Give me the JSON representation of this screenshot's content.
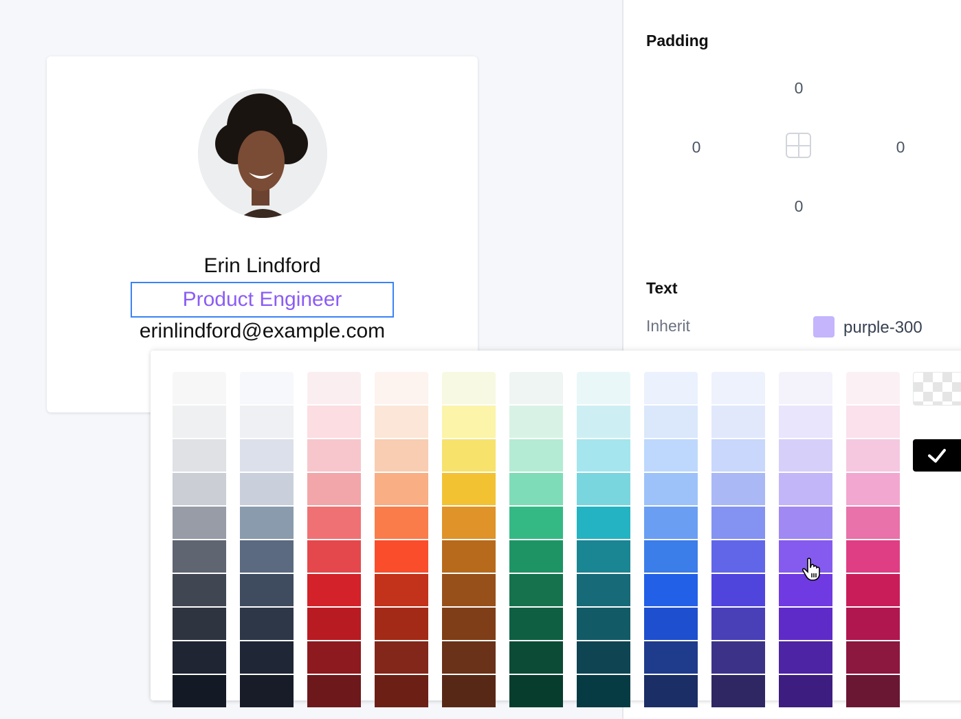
{
  "card": {
    "name": "Erin Lindford",
    "title": "Product Engineer",
    "email": "erinlindford@example.com",
    "title_color": "#8b5cf6",
    "selection_color": "#3b82f6"
  },
  "panel": {
    "padding_heading": "Padding",
    "padding": {
      "top": "0",
      "left": "0",
      "right": "0",
      "bottom": "0"
    },
    "text_heading": "Text",
    "inherit_label": "Inherit",
    "current_color_name": "purple-300",
    "current_color": "#c4b5fd"
  },
  "palette": {
    "selected": "purple-300",
    "columns": [
      [
        "#f7f7f8",
        "#eff0f2",
        "#dfe1e5",
        "#cbced4",
        "#979ca6",
        "#5f6571",
        "#404752",
        "#2e3440",
        "#1f2533",
        "#141a25"
      ],
      [
        "#f6f8fb",
        "#eef0f4",
        "#dce0ea",
        "#c9d0dc",
        "#8a9bad",
        "#5b6a80",
        "#3f4b5e",
        "#2e3748",
        "#1f2636",
        "#171c28"
      ],
      [
        "#fbeef0",
        "#fbdde2",
        "#f7c6cc",
        "#f2a6a9",
        "#f07174",
        "#e5484c",
        "#d32229",
        "#b91b23",
        "#8d1a1e",
        "#6d181b"
      ],
      [
        "#fdf3ef",
        "#fbe6d8",
        "#f9cdb1",
        "#f9ae84",
        "#fa7c4a",
        "#fa4d2c",
        "#c3321a",
        "#a32a17",
        "#83271a",
        "#6c1f14"
      ],
      [
        "#f8f9e2",
        "#fbf4a9",
        "#f7e26c",
        "#f2c233",
        "#df9329",
        "#b86a1c",
        "#97501a",
        "#7f3e17",
        "#6a3218",
        "#582816"
      ],
      [
        "#eff5f2",
        "#d8f3e6",
        "#b3ebd4",
        "#7fdcb8",
        "#34b985",
        "#1e9465",
        "#15724d",
        "#0f5f43",
        "#0c4b36",
        "#073d2d"
      ],
      [
        "#e9f7f8",
        "#cdeff3",
        "#a5e5ed",
        "#79d6de",
        "#23b3c2",
        "#1a8593",
        "#176a77",
        "#125a66",
        "#0f4553",
        "#073b44"
      ],
      [
        "#ebf1fd",
        "#dbe7fb",
        "#bdd8fc",
        "#9dc2fa",
        "#6a9ef3",
        "#3b7de9",
        "#2260e7",
        "#1e4fcf",
        "#1f3c8c",
        "#1c2e66"
      ],
      [
        "#eef2fd",
        "#e1e8fc",
        "#c8d7fb",
        "#aab9f6",
        "#8492f1",
        "#6166e9",
        "#4f45dd",
        "#4940b8",
        "#3c3388",
        "#2e2763"
      ],
      [
        "#f4f3fc",
        "#e8e5fc",
        "#d6cffa",
        "#c3b6f8",
        "#a189f3",
        "#855bef",
        "#6f3ae1",
        "#5f2bc8",
        "#4d24a3",
        "#3d1d7f"
      ],
      [
        "#fbf0f4",
        "#fae1ec",
        "#f5c8e0",
        "#f2a7d0",
        "#e872a9",
        "#df3e84",
        "#c91d5a",
        "#b0174f",
        "#8c173f",
        "#6a1734"
      ]
    ],
    "extra": [
      "transparent-icon",
      "check-icon"
    ]
  }
}
